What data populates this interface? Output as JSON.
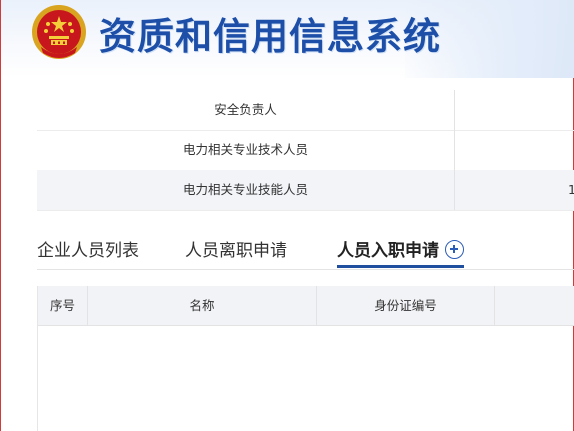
{
  "header": {
    "title": "资质和信用信息系统",
    "emblem_icon": "national-emblem-icon"
  },
  "info_rows": [
    {
      "label": "安全负责人",
      "value": ""
    },
    {
      "label": "电力相关专业技术人员",
      "value": ""
    },
    {
      "label": "电力相关专业技能人员",
      "value": "1"
    }
  ],
  "tabs": [
    {
      "label": "企业人员列表",
      "active": false
    },
    {
      "label": "人员离职申请",
      "active": false
    },
    {
      "label": "人员入职申请",
      "active": true
    }
  ],
  "grid": {
    "columns": [
      "序号",
      "名称",
      "身份证编号",
      ""
    ]
  },
  "colors": {
    "title_blue": "#1d4fa8",
    "accent": "#1f4f9e",
    "frame_red": "#d23b3b"
  }
}
